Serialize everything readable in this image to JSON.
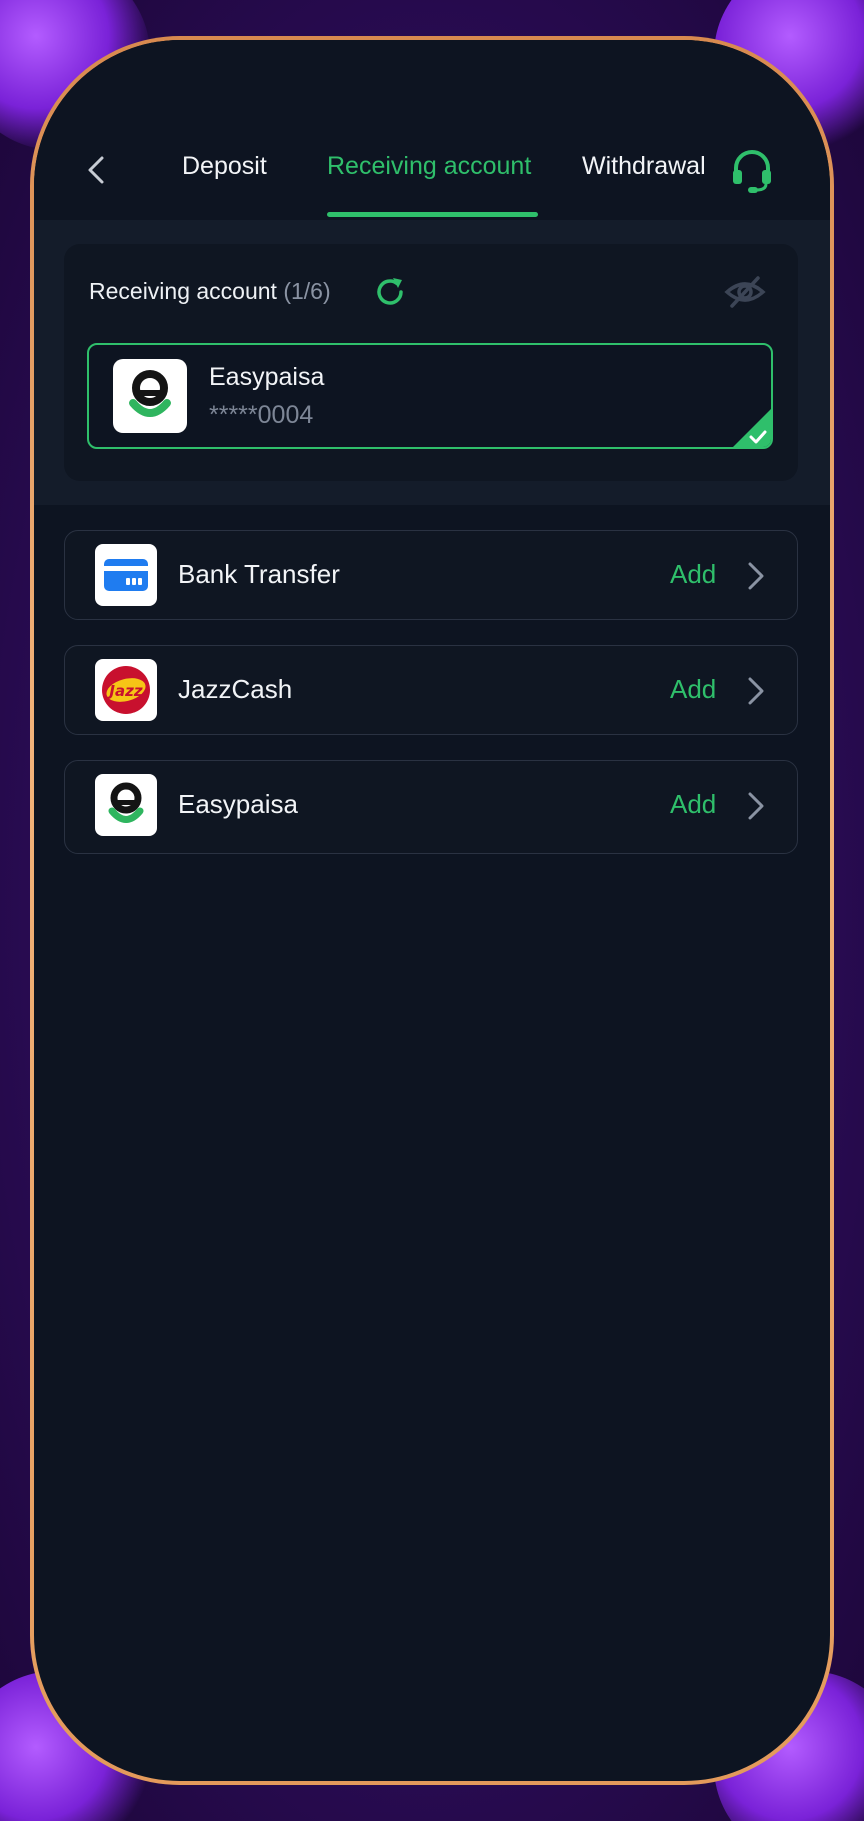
{
  "header": {
    "tabs": [
      {
        "label": "Deposit",
        "active": false
      },
      {
        "label": "Receiving account",
        "active": true
      },
      {
        "label": "Withdrawal",
        "active": false
      }
    ],
    "back_icon": "chevron-left-icon",
    "support_icon": "headset-icon"
  },
  "receiving": {
    "title": "Receiving account",
    "count": "(1/6)",
    "refresh_icon": "refresh-icon",
    "visibility_icon": "eye-off-icon",
    "selected_account": {
      "name": "Easypaisa",
      "number": "*****0004",
      "selected": true
    }
  },
  "methods": [
    {
      "label": "Bank Transfer",
      "action": "Add",
      "icon": "bank-card-icon"
    },
    {
      "label": "JazzCash",
      "action": "Add",
      "icon": "jazzcash-logo"
    },
    {
      "label": "Easypaisa",
      "action": "Add",
      "icon": "easypaisa-logo"
    }
  ],
  "colors": {
    "accent": "#2fbf6b",
    "background": "#0d1421",
    "card": "#0f1622",
    "frame": "#e8a368",
    "outer": "#2a0c55"
  }
}
